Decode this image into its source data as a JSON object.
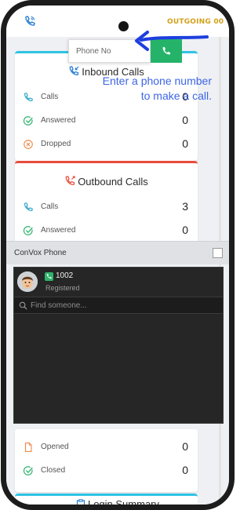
{
  "header": {
    "outgoing_label": "OUTGOING 00"
  },
  "dialer": {
    "phone_placeholder": "Phone No",
    "hint_line1": "Enter a phone number",
    "hint_line2": "to make a call."
  },
  "inbound": {
    "title": "Inbound Calls",
    "rows": [
      {
        "label": "Calls",
        "value": "0",
        "icon": "phone-icon"
      },
      {
        "label": "Answered",
        "value": "0",
        "icon": "check-circle-icon"
      },
      {
        "label": "Dropped",
        "value": "0",
        "icon": "x-circle-icon"
      }
    ]
  },
  "outbound": {
    "title": "Outbound Calls",
    "rows": [
      {
        "label": "Calls",
        "value": "3",
        "icon": "phone-icon"
      },
      {
        "label": "Answered",
        "value": "0",
        "icon": "check-circle-icon"
      }
    ]
  },
  "convox": {
    "title": "ConVox Phone",
    "extension": "1002",
    "status": "Registered",
    "search_placeholder": "Find someone..."
  },
  "tickets": {
    "rows": [
      {
        "label": "Opened",
        "value": "0",
        "icon": "document-icon"
      },
      {
        "label": "Closed",
        "value": "0",
        "icon": "check-circle-icon"
      }
    ]
  },
  "login_summary": {
    "title": "Login Summary"
  },
  "colors": {
    "inbound_accent": "#2fc3e3",
    "outbound_accent": "#e84c3d",
    "call_green": "#25b36a",
    "hint_blue": "#3c65e6",
    "outgoing_gold": "#d2a11a"
  }
}
